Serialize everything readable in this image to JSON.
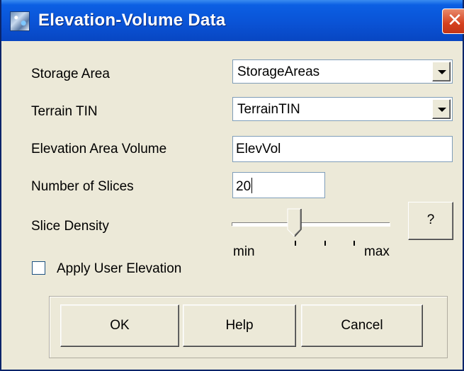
{
  "window": {
    "title": "Elevation-Volume Data",
    "close_glyph": "✕"
  },
  "form": {
    "storage_area": {
      "label": "Storage Area",
      "value": "StorageAreas"
    },
    "terrain_tin": {
      "label": "Terrain TIN",
      "value": "TerrainTIN"
    },
    "elevation_area_volume": {
      "label": "Elevation Area Volume",
      "value": "ElevVol"
    },
    "number_of_slices": {
      "label": "Number of Slices",
      "value": "20"
    },
    "slice_density": {
      "label": "Slice Density",
      "min_label": "min",
      "max_label": "max",
      "level_fraction": 0.4,
      "help_label": "?"
    },
    "apply_user_elevation": {
      "label": "Apply User Elevation",
      "checked": false
    }
  },
  "buttons": {
    "ok": "OK",
    "help": "Help",
    "cancel": "Cancel"
  },
  "icons": {
    "app": "map-icon",
    "close": "close-icon",
    "dropdown": "chevron-down-icon"
  },
  "colors": {
    "titlebar": "#0a53d6",
    "close": "#d5401e",
    "face": "#ece9d8"
  }
}
